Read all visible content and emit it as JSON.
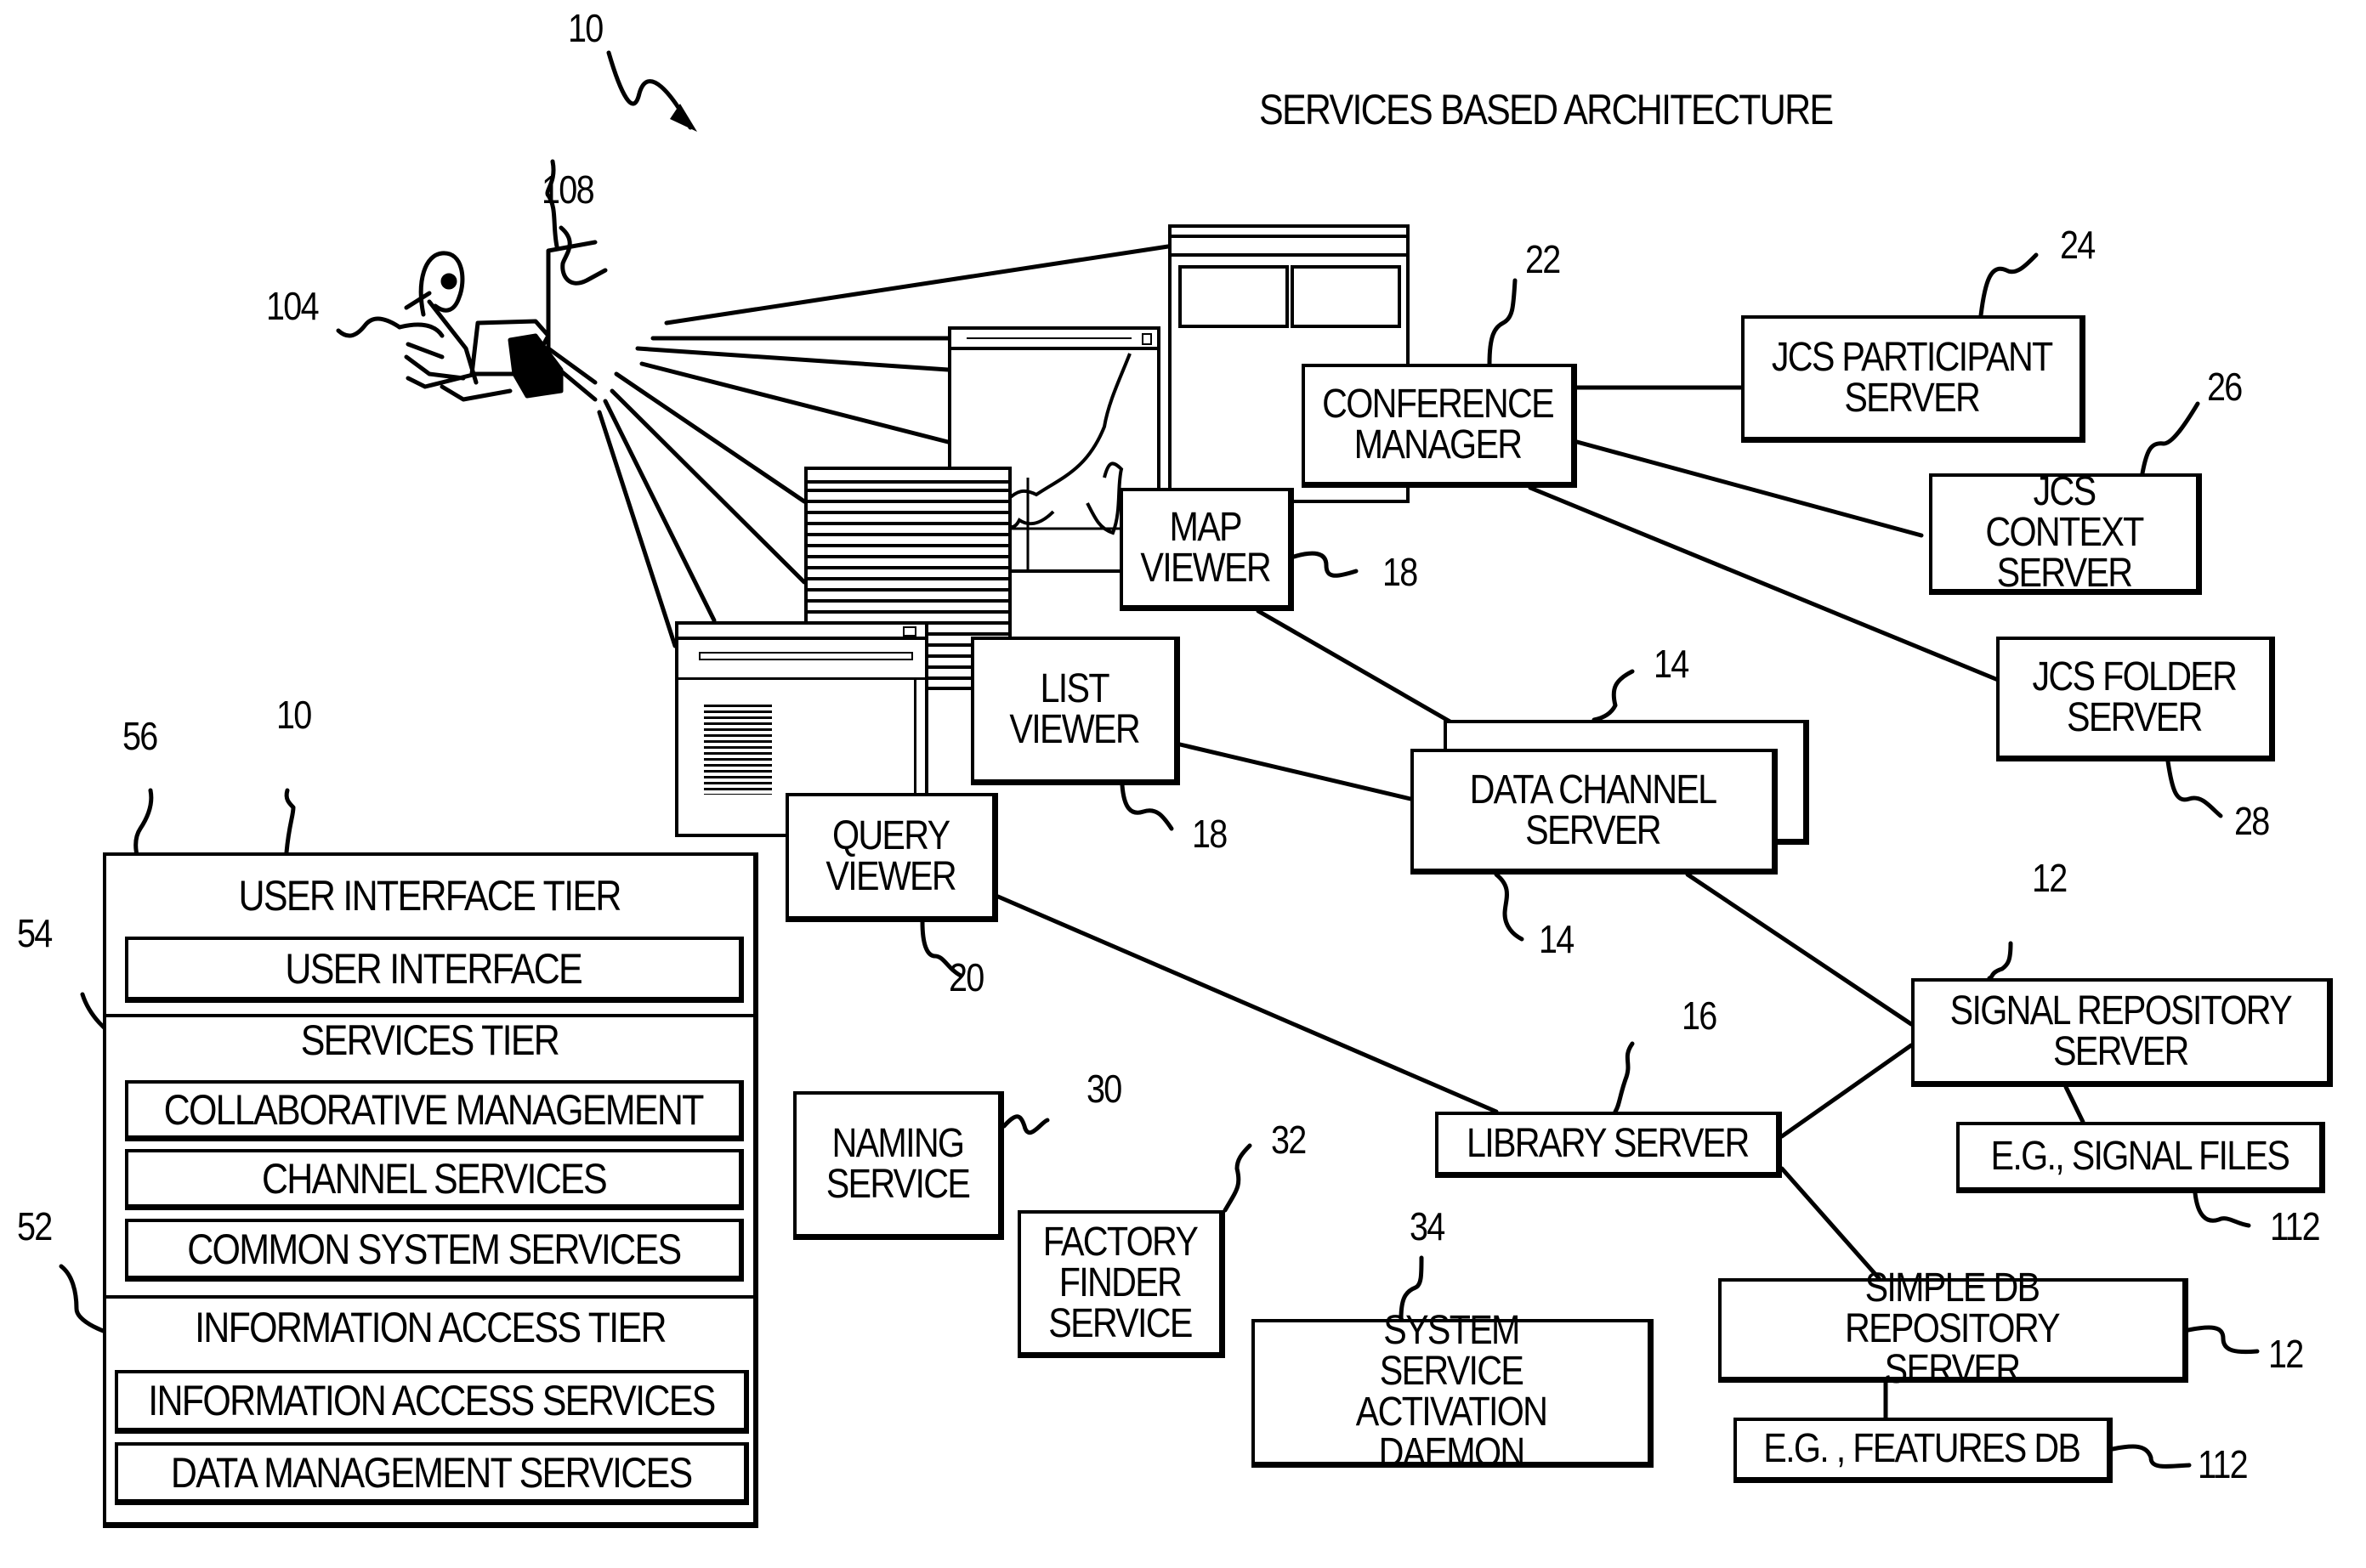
{
  "figure": {
    "title": "SERVICES BASED ARCHITECTURE",
    "ref_main": "10",
    "ref_user": "104",
    "ref_workstation": "108"
  },
  "nodes": {
    "conference_manager": {
      "label": "CONFERENCE\nMANAGER",
      "ref": "22"
    },
    "jcs_participant": {
      "label": "JCS PARTICIPANT\nSERVER",
      "ref": "24"
    },
    "jcs_context": {
      "label": "JCS CONTEXT\nSERVER",
      "ref": "26"
    },
    "jcs_folder": {
      "label": "JCS FOLDER\nSERVER",
      "ref": "28"
    },
    "map_viewer": {
      "label": "MAP\nVIEWER",
      "ref": "18"
    },
    "list_viewer": {
      "label": "LIST\nVIEWER",
      "ref": "18"
    },
    "query_viewer": {
      "label": "QUERY\nVIEWER",
      "ref": "20"
    },
    "data_channel": {
      "label": "DATA CHANNEL\nSERVER",
      "ref_top": "14",
      "ref_bottom": "14"
    },
    "library_server": {
      "label": "LIBRARY SERVER",
      "ref": "16"
    },
    "signal_repository": {
      "label": "SIGNAL REPOSITORY\nSERVER",
      "ref": "12"
    },
    "signal_files": {
      "label": "E.G., SIGNAL FILES",
      "ref": "112"
    },
    "simple_db": {
      "label": "SIMPLE DB REPOSITORY\nSERVER",
      "ref": "12"
    },
    "features_db": {
      "label": "E.G. , FEATURES DB",
      "ref": "112"
    },
    "naming_service": {
      "label": "NAMING\nSERVICE",
      "ref": "30"
    },
    "factory_finder": {
      "label": "FACTORY\nFINDER\nSERVICE",
      "ref": "32"
    },
    "ssad": {
      "label": "SYSTEM\nSERVICE ACTIVATION\nDAEMON",
      "ref": "34"
    }
  },
  "tiers": {
    "ref_box": "10",
    "ui_tier": {
      "heading": "USER INTERFACE TIER",
      "ref": "56",
      "items": [
        "USER INTERFACE"
      ]
    },
    "services_tier": {
      "heading": "SERVICES TIER",
      "ref": "54",
      "items": [
        "COLLABORATIVE MANAGEMENT",
        "CHANNEL SERVICES",
        "COMMON SYSTEM SERVICES"
      ]
    },
    "info_tier": {
      "heading": "INFORMATION ACCESS TIER",
      "ref": "52",
      "items": [
        "INFORMATION ACCESS SERVICES",
        "DATA MANAGEMENT SERVICES"
      ]
    }
  }
}
